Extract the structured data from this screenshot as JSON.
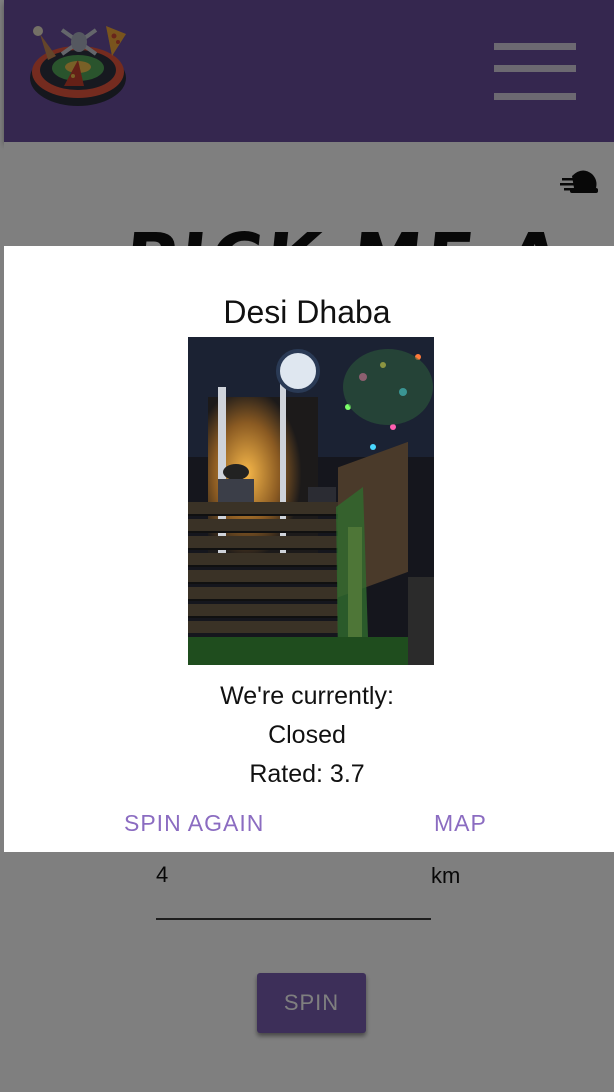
{
  "header": {
    "logo_icon": "roulette-food-logo-icon",
    "menu_icon": "hamburger-menu-icon",
    "bar_color": "#6b4f9e"
  },
  "main": {
    "fast_icon": "fast-food-speed-icon",
    "heading": "PICK ME A",
    "distance": {
      "value": "4",
      "unit": "km"
    },
    "spin_label": "SPIN"
  },
  "dialog": {
    "title": "Desi Dhaba",
    "photo_icon": "restaurant-photo",
    "status_label": "We're currently:",
    "status_value": "Closed",
    "rating_prefix": "Rated: ",
    "rating_value": "3.7",
    "actions": {
      "spin_again": "SPIN AGAIN",
      "map": "MAP"
    },
    "accent_color": "#8b6cc1"
  }
}
